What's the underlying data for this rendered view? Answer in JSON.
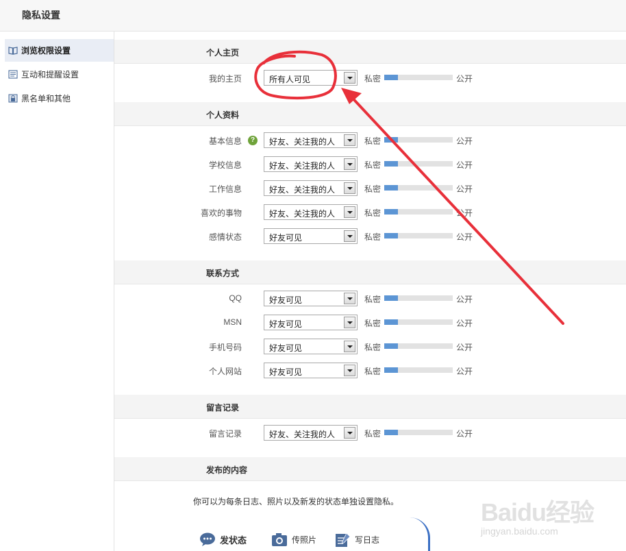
{
  "page_title": "隐私设置",
  "sidebar": {
    "items": [
      {
        "label": "浏览权限设置",
        "icon": "book-icon",
        "active": true
      },
      {
        "label": "互动和提醒设置",
        "icon": "list-icon",
        "active": false
      },
      {
        "label": "黑名单和其他",
        "icon": "lock-icon",
        "active": false
      }
    ]
  },
  "sections": [
    {
      "title": "个人主页",
      "rows": [
        {
          "label": "我的主页",
          "value": "所有人可见",
          "private_label": "私密",
          "public_label": "公开",
          "level": 0.2
        }
      ]
    },
    {
      "title": "个人资料",
      "rows": [
        {
          "label": "基本信息",
          "value": "好友、关注我的人",
          "private_label": "私密",
          "public_label": "公开",
          "level": 0.2,
          "help": "?"
        },
        {
          "label": "学校信息",
          "value": "好友、关注我的人",
          "private_label": "私密",
          "public_label": "公开",
          "level": 0.2
        },
        {
          "label": "工作信息",
          "value": "好友、关注我的人",
          "private_label": "私密",
          "public_label": "公开",
          "level": 0.2
        },
        {
          "label": "喜欢的事物",
          "value": "好友、关注我的人",
          "private_label": "私密",
          "public_label": "公开",
          "level": 0.2
        },
        {
          "label": "感情状态",
          "value": "好友可见",
          "private_label": "私密",
          "public_label": "公开",
          "level": 0.2
        }
      ]
    },
    {
      "title": "联系方式",
      "rows": [
        {
          "label": "QQ",
          "value": "好友可见",
          "private_label": "私密",
          "public_label": "公开",
          "level": 0.2
        },
        {
          "label": "MSN",
          "value": "好友可见",
          "private_label": "私密",
          "public_label": "公开",
          "level": 0.2
        },
        {
          "label": "手机号码",
          "value": "好友可见",
          "private_label": "私密",
          "public_label": "公开",
          "level": 0.2
        },
        {
          "label": "个人网站",
          "value": "好友可见",
          "private_label": "私密",
          "public_label": "公开",
          "level": 0.2
        }
      ]
    },
    {
      "title": "留言记录",
      "rows": [
        {
          "label": "留言记录",
          "value": "好友、关注我的人",
          "private_label": "私密",
          "public_label": "公开",
          "level": 0.2
        }
      ]
    },
    {
      "title": "发布的内容",
      "rows": []
    }
  ],
  "content_note": "你可以为每条日志、照片以及新发的状态单独设置隐私。",
  "post_buttons": [
    {
      "label": "发状态",
      "icon": "speech-bubble-icon"
    },
    {
      "label": "传照片",
      "icon": "camera-icon"
    },
    {
      "label": "写日志",
      "icon": "notepad-icon"
    }
  ],
  "colors": {
    "bar_fill": "#5c95d4",
    "bar_track": "#e2e2e2",
    "annotation": "#e8303a",
    "help_badge": "#6fa33a"
  },
  "watermark": {
    "main": "Baidu经验",
    "sub": "jingyan.baidu.com"
  }
}
